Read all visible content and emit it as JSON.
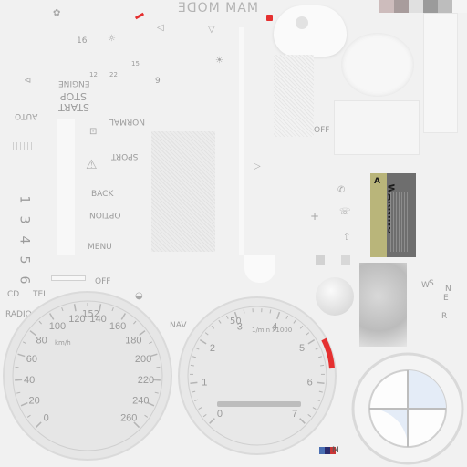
{
  "top": {
    "mode_label": "MODE",
    "mode_prefix": "MAM",
    "swatches": [
      "#cdbcbc",
      "#a89c9c",
      "#e0e0e0",
      "#9b9b9b",
      "#bdbdbd",
      "#f4f4f4"
    ]
  },
  "left_labels": {
    "engine": "ENGINE",
    "stop": "STOP",
    "start": "START",
    "auto": "AUTO",
    "normal": "NORMAL",
    "sport": "SPORT",
    "back": "BACK",
    "option": "OPTION",
    "menu": "MENU",
    "off": "OFF",
    "cd": "CD",
    "tel": "TEL",
    "radio": "RADIO",
    "nav": "NAV"
  },
  "small_numbers": [
    "16",
    "22",
    "15",
    "12",
    "9"
  ],
  "right_labels": {
    "off": "OFF",
    "warning": "WARNING",
    "warning_symbol": "A"
  },
  "compass": {
    "n": "N",
    "s": "S",
    "e": "E",
    "w": "W",
    "r": "R"
  },
  "speedo": {
    "ticks": [
      "0",
      "20",
      "40",
      "60",
      "80",
      "100",
      "120",
      "140",
      "160",
      "180",
      "200",
      "220",
      "240",
      "260"
    ],
    "top_label": "152",
    "unit": "km/h"
  },
  "tach": {
    "ticks": [
      "0",
      "1",
      "2",
      "3",
      "4",
      "5",
      "6",
      "7"
    ],
    "top_label": "50",
    "unit": "1/min x1000"
  },
  "colors": {
    "accent_red": "#e53030",
    "face": "#e6e6e6",
    "ring": "#dcdcdc"
  },
  "logo": {
    "emblem": "M"
  }
}
